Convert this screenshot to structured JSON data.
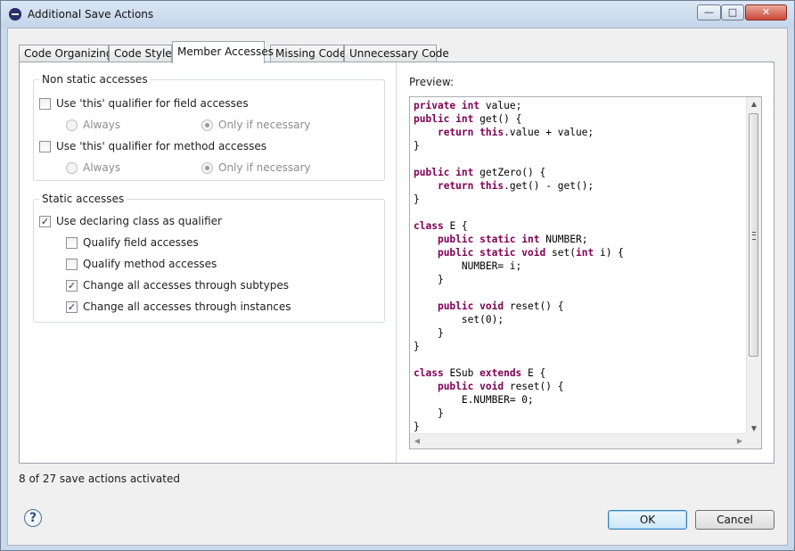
{
  "window": {
    "title": "Additional Save Actions",
    "controls": {
      "minimize": "—",
      "maximize": "□",
      "close": "✕"
    }
  },
  "tabs": [
    {
      "label": "Code Organizing"
    },
    {
      "label": "Code Style"
    },
    {
      "label": "Member Accesses",
      "active": true
    },
    {
      "label": "Missing Code"
    },
    {
      "label": "Unnecessary Code"
    }
  ],
  "non_static": {
    "title": "Non static accesses",
    "field": {
      "label": "Use 'this' qualifier for field accesses",
      "checked": false,
      "always": "Always",
      "only_if_necessary": "Only if necessary",
      "selected": "only_if_necessary"
    },
    "method": {
      "label": "Use 'this' qualifier for method accesses",
      "checked": false,
      "always": "Always",
      "only_if_necessary": "Only if necessary",
      "selected": "only_if_necessary"
    }
  },
  "static": {
    "title": "Static accesses",
    "use_declaring": {
      "label": "Use declaring class as qualifier",
      "checked": true
    },
    "qualify_field": {
      "label": "Qualify field accesses",
      "checked": false
    },
    "qualify_method": {
      "label": "Qualify method accesses",
      "checked": false
    },
    "through_subtypes": {
      "label": "Change all accesses through subtypes",
      "checked": true
    },
    "through_instances": {
      "label": "Change all accesses through instances",
      "checked": true
    }
  },
  "preview": {
    "label": "Preview:",
    "code": [
      "private int value;",
      "public int get() {",
      "    return this.value + value;",
      "}",
      "",
      "public int getZero() {",
      "    return this.get() - get();",
      "}",
      "",
      "class E {",
      "    public static int NUMBER;",
      "    public static void set(int i) {",
      "        NUMBER= i;",
      "    }",
      "",
      "    public void reset() {",
      "        set(0);",
      "    }",
      "}",
      "",
      "class ESub extends E {",
      "    public void reset() {",
      "        E.NUMBER= 0;",
      "    }",
      "}"
    ],
    "keywords": [
      "private",
      "public",
      "int",
      "return",
      "this",
      "class",
      "static",
      "void",
      "extends"
    ]
  },
  "status": "8 of 27 save actions activated",
  "buttons": {
    "help": "?",
    "ok": "OK",
    "cancel": "Cancel"
  },
  "colors": {
    "keyword": "#7f0055",
    "ok_border": "#3c7fb1"
  }
}
